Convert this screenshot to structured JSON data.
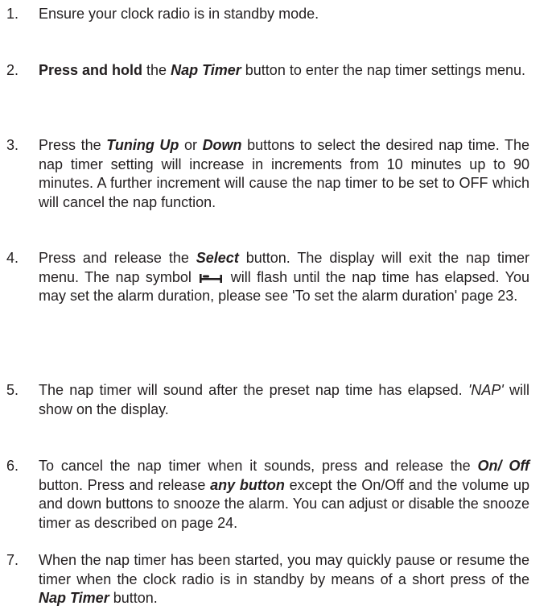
{
  "steps": [
    {
      "num": "1.",
      "text": "Ensure your clock radio is in standby mode."
    },
    {
      "num": "2.",
      "bold1": "Press and hold",
      "text1": " the ",
      "bi1": "Nap Timer",
      "text2": " button to enter the nap timer settings menu."
    },
    {
      "num": "3.",
      "text1": "Press the ",
      "bi1": "Tuning Up",
      "text2": " or ",
      "bi2": "Down",
      "text3": " buttons to select the desired nap time. The nap timer setting will increase in increments from 10 minutes up to 90 minutes. A further increment will cause the nap timer to be set to OFF which will cancel the nap function."
    },
    {
      "num": "4.",
      "text1": "Press and release the ",
      "bi1": "Select",
      "text2": " button. The display will exit the nap timer menu. The nap symbol ",
      "icon": "nap-bed-icon",
      "text3": " will flash until the nap time has elapsed. You may set the alarm duration, please see 'To set the alarm duration' page 23."
    },
    {
      "num": "5.",
      "text1": "The nap timer will sound  after the preset nap time has elapsed. ",
      "i1": "'NAP'",
      "text2": " will show on the display."
    },
    {
      "num": "6.",
      "text1": "To cancel the nap timer when it sounds, press and release the ",
      "bi1": "On/ Off",
      "text2": " button. Press and release ",
      "bi2": "any button",
      "text3": " except the On/Off and the volume up and down buttons to snooze the alarm. You can adjust or disable the snooze timer as described on page 24."
    },
    {
      "num": "7.",
      "text1": "When the nap timer has been started, you may quickly pause or resume the timer when the clock radio is in standby by means of a short press of the ",
      "bi1": "Nap Timer",
      "text2": " button."
    }
  ]
}
